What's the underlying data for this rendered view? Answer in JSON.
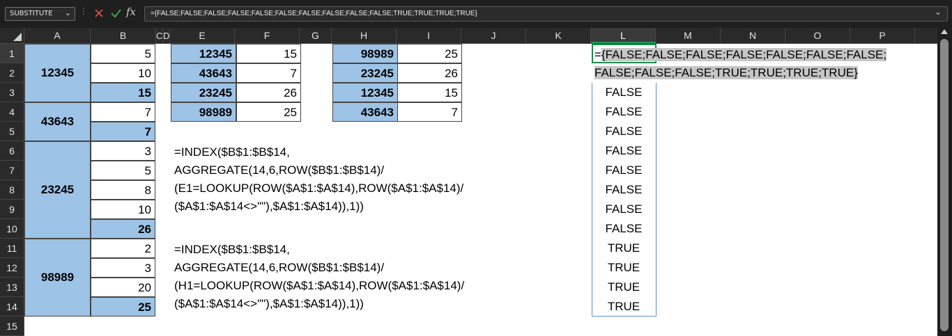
{
  "formula_bar": {
    "name_box": "SUBSTITUTE",
    "formula": "={FALSE;FALSE;FALSE;FALSE;FALSE;FALSE;FALSE;FALSE;FALSE;FALSE;TRUE;TRUE;TRUE;TRUE}",
    "fx_label": "fx",
    "cancel_icon": "x-icon",
    "enter_icon": "check-icon"
  },
  "columns": [
    "A",
    "B",
    "C",
    "D",
    "E",
    "F",
    "G",
    "H",
    "I",
    "J",
    "K",
    "L",
    "M",
    "N",
    "O",
    "P"
  ],
  "rows": [
    "1",
    "2",
    "3",
    "4",
    "5",
    "6",
    "7",
    "8",
    "9",
    "10",
    "11",
    "12",
    "13",
    "14",
    "15"
  ],
  "colA_groups": [
    "12345",
    "43643",
    "23245",
    "98989"
  ],
  "colB_values": [
    "5",
    "10",
    "15",
    "7",
    "7",
    "3",
    "5",
    "8",
    "10",
    "26",
    "2",
    "3",
    "20",
    "25"
  ],
  "table_EF": [
    {
      "key": "12345",
      "value": "15"
    },
    {
      "key": "43643",
      "value": "7"
    },
    {
      "key": "23245",
      "value": "26"
    },
    {
      "key": "98989",
      "value": "25"
    }
  ],
  "table_HI": [
    {
      "key": "98989",
      "value": "25"
    },
    {
      "key": "23245",
      "value": "26"
    },
    {
      "key": "12345",
      "value": "15"
    },
    {
      "key": "43643",
      "value": "7"
    }
  ],
  "formula1": [
    "=INDEX($B$1:$B$14,",
    "AGGREGATE(14,6,ROW($B$1:$B$14)/",
    "(E1=LOOKUP(ROW($A$1:$A$14),ROW($A$1:$A$14)/",
    "($A$1:$A$14<>\"\"),$A$1:$A$14)),1))"
  ],
  "formula2": [
    "=INDEX($B$1:$B$14,",
    "AGGREGATE(14,6,ROW($B$1:$B$14)/",
    "(H1=LOOKUP(ROW($A$1:$A$14),ROW($A$1:$A$14)/",
    "($A$1:$A$14<>\"\"),$A$1:$A$14)),1))"
  ],
  "spill_line1_prefix": "=",
  "spill_line1": "{FALSE;FALSE;FALSE;FALSE;FALSE;FALSE;FALSE;",
  "spill_line2": "FALSE;FALSE;FALSE;TRUE;TRUE;TRUE;TRUE}",
  "colL_values": [
    "FALSE",
    "FALSE",
    "FALSE",
    "FALSE",
    "FALSE",
    "FALSE",
    "FALSE",
    "FALSE",
    "TRUE",
    "TRUE",
    "TRUE",
    "TRUE"
  ],
  "colors": {
    "accent_green": "#1e8a4a",
    "cell_blue": "#9dc3e6",
    "spill_border": "#5b8fd6"
  }
}
